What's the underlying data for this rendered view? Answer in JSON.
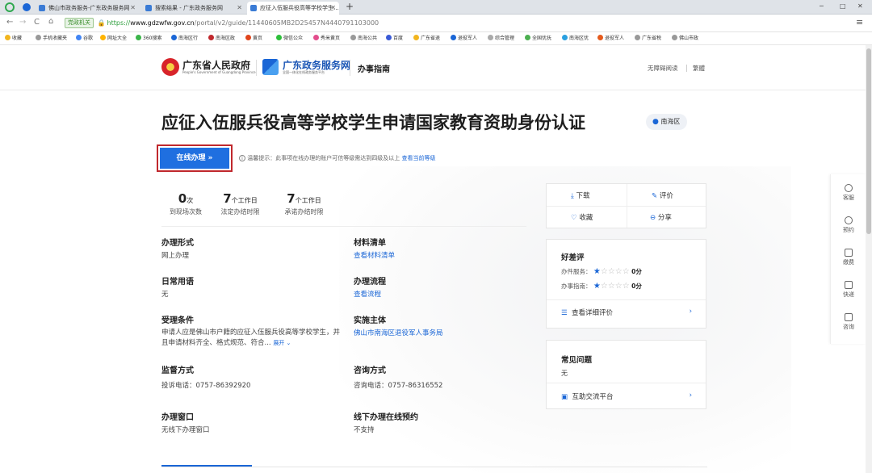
{
  "browser": {
    "tabs": [
      {
        "label": "佛山市政务服务-广东政务服务网"
      },
      {
        "label": "搜索结果 - 广东政务服务网"
      },
      {
        "label": "应征入伍服兵役高等学校学生..."
      }
    ],
    "new_tab": "+",
    "address_badge": "党政机关",
    "url_prefix": "https://",
    "url_host": "www.gdzwfw.gov.cn",
    "url_path": "/portal/v2/guide/11440605MB2D25457N4440791103000",
    "window_controls": [
      "□",
      "─",
      "✕"
    ],
    "bookmarks": [
      "收藏",
      "手机收藏夹",
      "谷歌",
      "网址大全",
      "360搜索",
      "南海区行",
      "南海区政",
      "黄页",
      "微信公众",
      "秀米黄页",
      "南海公共",
      "百度",
      "广东省退",
      "退役军人",
      "综合管理",
      "全国优抚",
      "南海区优",
      "退役军人",
      "广东省税",
      "佛山市政"
    ]
  },
  "header": {
    "gov_title": "广东省人民政府",
    "gov_subtitle": "People's Government of Guangdong Province",
    "portal_title": "广东政务服务网",
    "portal_subtitle": "全国一体化在线政务服务平台",
    "section": "办事指南",
    "accessibility": "无障碍阅读",
    "traditional": "繁體"
  },
  "main": {
    "title": "应征入伍服兵役高等学校学生申请国家教育资助身份认证",
    "region_badge": "南海区",
    "apply_button": "在线办理 »",
    "tip_text": "温馨提示：此事项在线办理的账户可信等级需达到四级及以上",
    "tip_link": "查看当前等级",
    "stats": [
      {
        "num": "0",
        "unit": "次",
        "label": "到现场次数"
      },
      {
        "num": "7",
        "unit": "个工作日",
        "label": "法定办结时限"
      },
      {
        "num": "7",
        "unit": "个工作日",
        "label": "承诺办结时限"
      }
    ],
    "fields": {
      "mode_label": "办理形式",
      "mode_value": "网上办理",
      "materials_label": "材料清单",
      "materials_value": "查看材料清单",
      "terms_label": "日常用语",
      "terms_value": "无",
      "process_label": "办理流程",
      "process_value": "查看流程",
      "conditions_label": "受理条件",
      "conditions_value": "申请人应是佛山市户籍的应征入伍服兵役高等学校学生，并且申请材料齐全、格式规范、符合...",
      "expand": "展开",
      "agency_label": "实施主体",
      "agency_value": "佛山市南海区退役军人事务局",
      "supervision_label": "监督方式",
      "supervision_value": "投诉电话：0757-86392920",
      "consult_label": "咨询方式",
      "consult_value": "咨询电话：0757-86316552",
      "window_label": "办理窗口",
      "window_value": "无线下办理窗口",
      "offline_label": "线下办理在线预约",
      "offline_value": "不支持"
    }
  },
  "sidebar": {
    "download": "下载",
    "evaluate": "评价",
    "favorite": "收藏",
    "share": "分享",
    "rating_title": "好差评",
    "ratings": [
      {
        "label": "办件服务：",
        "stars": 1,
        "max": 5,
        "score": "0分"
      },
      {
        "label": "办事指南：",
        "stars": 1,
        "max": 5,
        "score": "0分"
      }
    ],
    "detail_link": "查看详细评价",
    "faq_title": "常见问题",
    "faq_value": "无",
    "interact_link": "互助交流平台"
  },
  "float_bar": [
    "客服",
    "预约",
    "缴费",
    "快递",
    "咨询"
  ],
  "colors": {
    "accent": "#1a66d6",
    "apply_bg": "#1f6fe0",
    "highlight": "#c0282d"
  }
}
